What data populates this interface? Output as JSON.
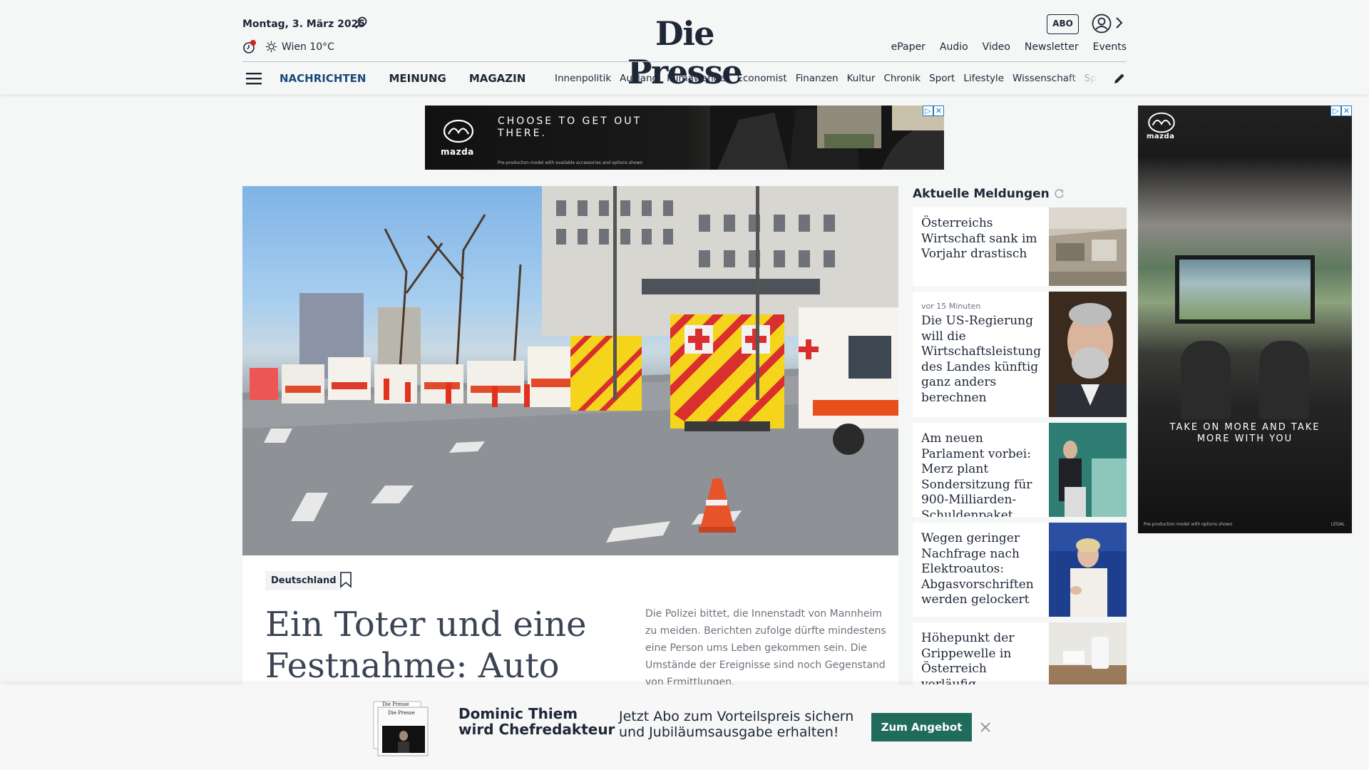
{
  "header": {
    "date": "Montag, 3. März 2025",
    "weather": "Wien 10°C",
    "logo": "Die Presse",
    "abo_label": "ABO",
    "top_links": [
      "ePaper",
      "Audio",
      "Video",
      "Newsletter",
      "Events"
    ]
  },
  "nav": {
    "main": [
      "NACHRICHTEN",
      "MEINUNG",
      "MAGAZIN"
    ],
    "sections": [
      "Innenpolitik",
      "Ausland",
      "Klimawandel",
      "Economist",
      "Finanzen",
      "Kultur",
      "Chronik",
      "Sport",
      "Lifestyle",
      "Wissenschaft",
      "Spectrum"
    ]
  },
  "ads": {
    "top_brand": "mazda",
    "top_headline_1": "CHOOSE TO GET OUT",
    "top_headline_2": "THERE.",
    "top_fine": "Pre-production model with available accessories and options shown",
    "side_brand": "mazda",
    "side_headline_1": "TAKE ON MORE AND TAKE",
    "side_headline_2": "MORE WITH YOU",
    "side_fine": "Pre-production model with options shown",
    "side_legal": "LEGAL"
  },
  "lead": {
    "tag": "Deutschland",
    "title": "Ein Toter und eine Festnahme: Auto rast",
    "teaser": "Die Polizei bittet, die Innenstadt von Mannheim zu meiden. Berichten zufolge dürfte mindestens eine Person ums Leben gekommen sein. Die Umstände der Ereignisse sind noch Gegenstand von Ermittlungen."
  },
  "news": {
    "heading": "Aktuelle Meldungen",
    "items": [
      {
        "meta": "",
        "title": "Österreichs Wirtschaft sank im Vorjahr drastisch"
      },
      {
        "meta": "vor 15 Minuten",
        "title": "Die US-Regierung will die Wirtschaftsleistung des Landes künftig ganz anders berechnen"
      },
      {
        "meta": "",
        "title": "Am neuen Parlament vorbei: Merz plant Sondersitzung für 900-Milliarden-Schuldenpaket"
      },
      {
        "meta": "",
        "title": "Wegen geringer Nachfrage nach Elektroautos: Abgasvorschriften werden gelockert"
      },
      {
        "meta": "",
        "title": "Höhepunkt der Grippewelle in Österreich vorläufig überschritten"
      }
    ]
  },
  "promo": {
    "name_line_1": "Dominic Thiem",
    "name_line_2": "wird Chefredakteur",
    "text_line_1": "Jetzt Abo zum Vorteilspreis sichern",
    "text_line_2": "und Jubiläumsausgabe erhalten!",
    "button": "Zum Angebot"
  },
  "colors": {
    "nav_active": "#1a4a7a",
    "promo_button": "#1f6b5c",
    "text": "#1d2736"
  }
}
